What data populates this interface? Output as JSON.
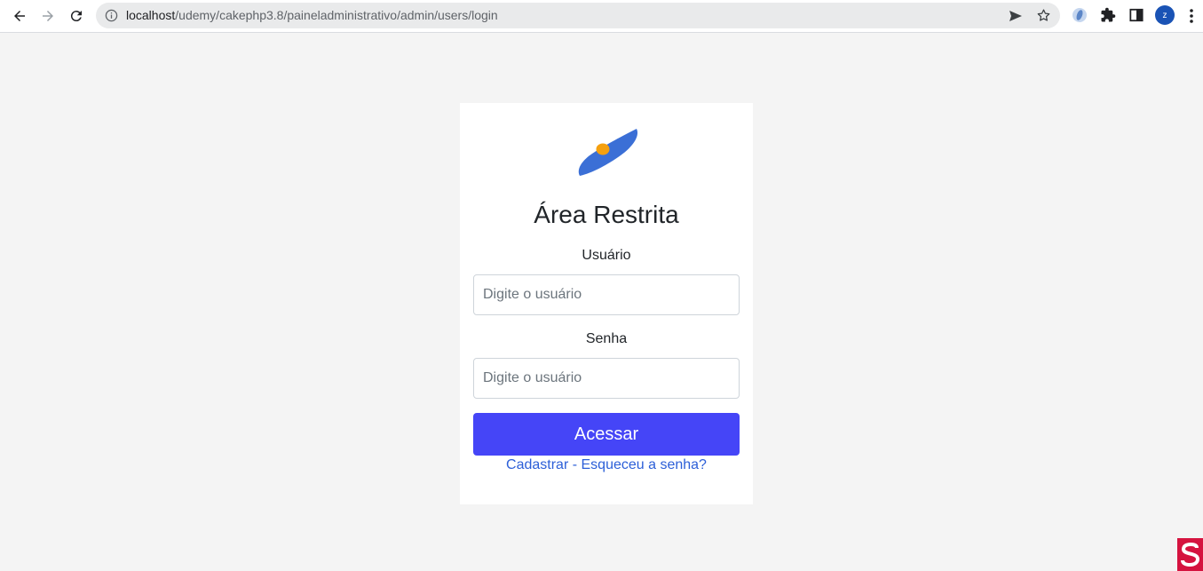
{
  "browser": {
    "url_host": "localhost",
    "url_path": "/udemy/cakephp3.8/paineladministrativo/admin/users/login",
    "profile_initial": "z",
    "icons": [
      "back-arrow-icon",
      "forward-arrow-icon",
      "reload-icon",
      "info-icon",
      "send-icon",
      "star-icon",
      "extension-icon",
      "puzzle-icon",
      "sidebar-icon",
      "menu-dots-icon"
    ]
  },
  "login": {
    "title": "Área Restrita",
    "user_label": "Usuário",
    "user_placeholder": "Digite o usuário",
    "password_label": "Senha",
    "password_placeholder": "Digite o usuário",
    "submit_label": "Acessar",
    "register_link": "Cadastrar",
    "separator": " - ",
    "forgot_link": "Esqueceu a senha?"
  },
  "colors": {
    "accent": "#4545f7",
    "link": "#2c5fd8",
    "logo_blue": "#3b6fd6",
    "logo_orange": "#f5a00f",
    "page_bg": "#f4f4f4"
  }
}
